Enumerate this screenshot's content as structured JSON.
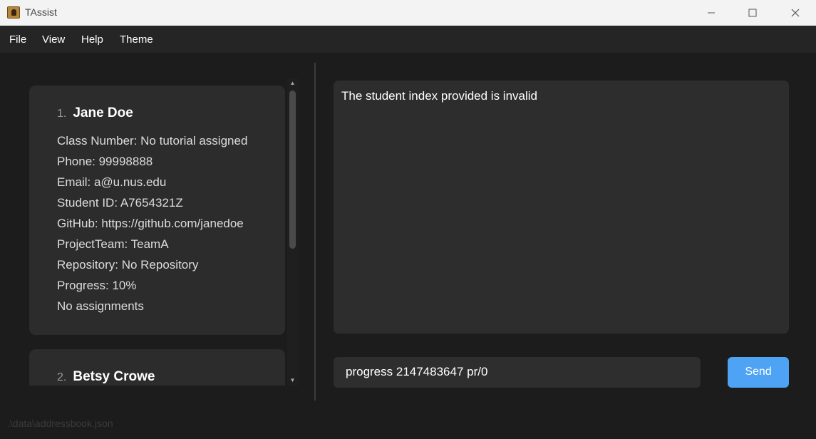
{
  "window": {
    "title": "TAssist"
  },
  "menu": [
    "File",
    "View",
    "Help",
    "Theme"
  ],
  "students": [
    {
      "index": "1.",
      "name": "Jane Doe",
      "fields": [
        "Class Number: No tutorial assigned",
        "Phone: 99998888",
        "Email: a@u.nus.edu",
        "Student ID: A7654321Z",
        "GitHub: https://github.com/janedoe",
        "ProjectTeam: TeamA",
        "Repository: No Repository",
        "Progress: 10%",
        "No assignments"
      ]
    },
    {
      "index": "2.",
      "name": "Betsy Crowe"
    }
  ],
  "result": {
    "text": "The student index provided is invalid"
  },
  "command": {
    "value": "progress 2147483647 pr/0"
  },
  "send_label": "Send",
  "status_bar": {
    "path": ".\\data\\addressbook.json"
  },
  "colors": {
    "accent": "#4ea3f5",
    "card": "#2c2c2c",
    "background": "#1c1c1c"
  }
}
